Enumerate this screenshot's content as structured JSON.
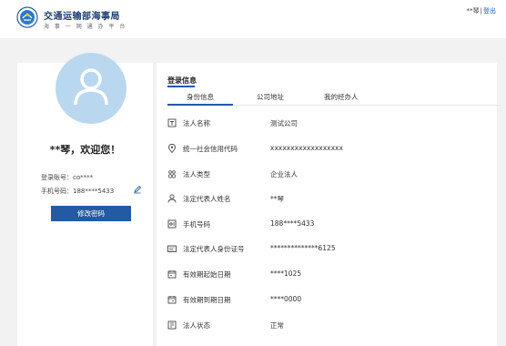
{
  "header": {
    "org_name": "交通运输部海事局",
    "org_sub": "海 事 一 网 通 办 平 台",
    "user_name": "**琴",
    "separator": "|",
    "logout": "登出"
  },
  "profile": {
    "welcome": "**琴，欢迎您！",
    "account_label": "登录账号：co****",
    "phone_label": "手机号码：188****5433",
    "change_password": "修改密码"
  },
  "info": {
    "section_title": "登录信息",
    "tabs": [
      {
        "label": "身份信息",
        "active": true
      },
      {
        "label": "公司地址",
        "active": false
      },
      {
        "label": "我的经办人",
        "active": false
      }
    ],
    "rows": [
      {
        "icon": "id-card-icon",
        "label": "法人名称",
        "value": "测试公司"
      },
      {
        "icon": "location-pin-icon",
        "label": "统一社会信用代码",
        "value": "xxxxxxxxxxxxxxxxxx"
      },
      {
        "icon": "group-icon",
        "label": "法人类型",
        "value": "企业法人"
      },
      {
        "icon": "person-icon",
        "label": "法定代表人姓名",
        "value": "**琴"
      },
      {
        "icon": "phone-card-icon",
        "label": "手机号码",
        "value": "188****5433"
      },
      {
        "icon": "id-document-icon",
        "label": "法定代表人身份证号",
        "value": "**************6125"
      },
      {
        "icon": "calendar-start-icon",
        "label": "有效期起始日期",
        "value": "****1025"
      },
      {
        "icon": "calendar-end-icon",
        "label": "有效期到期日期",
        "value": "****0000"
      },
      {
        "icon": "status-icon",
        "label": "法人状态",
        "value": "正常"
      }
    ]
  },
  "colors": {
    "accent": "#245aa3",
    "avatar_bg": "#b9d8f0",
    "background": "#f2f2f2"
  }
}
